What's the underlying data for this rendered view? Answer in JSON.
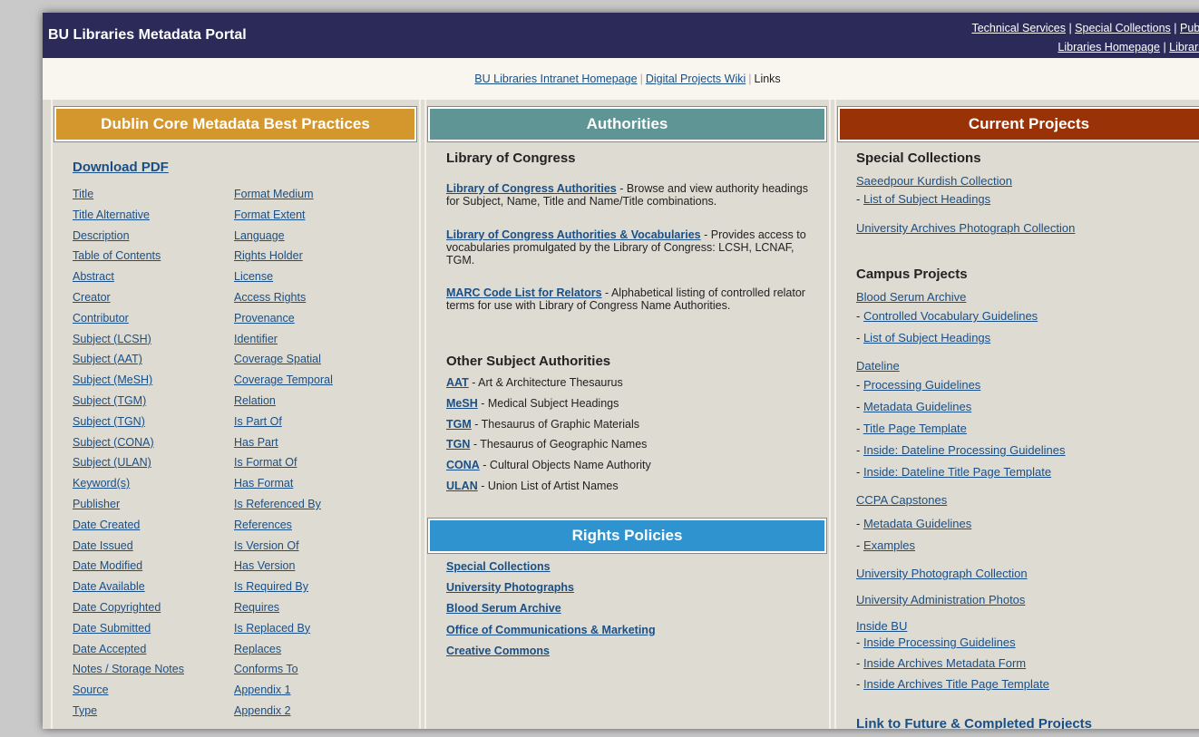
{
  "header": {
    "site_title": "BU Libraries Metadata Portal",
    "top_links_row1": [
      "Technical Services",
      "Special Collections",
      "Public Servi"
    ],
    "top_links_row2": [
      "Libraries Homepage",
      "Libraries Cata"
    ]
  },
  "subnav": {
    "intranet": "BU Libraries Intranet Homepage",
    "wiki": "Digital Projects Wiki",
    "links": "Links",
    "sep": "|"
  },
  "dublin_core": {
    "heading": "Dublin Core Metadata Best Practices",
    "download": "Download PDF",
    "left_fields": [
      "Title",
      "Title Alternative",
      "Description",
      "Table of Contents",
      "Abstract",
      "Creator",
      "Contributor",
      "Subject (LCSH)",
      "Subject (AAT)",
      "Subject (MeSH)",
      "Subject (TGM)",
      "Subject (TGN)",
      "Subject (CONA)",
      "Subject (ULAN)",
      "Keyword(s)",
      "Publisher",
      "Date Created",
      "Date Issued",
      "Date Modified",
      "Date Available",
      "Date Copyrighted",
      "Date Submitted",
      "Date Accepted",
      "Notes / Storage Notes",
      "Source",
      "Type"
    ],
    "right_fields": [
      "Format Medium",
      "Format Extent",
      "Language",
      "Rights Holder",
      "License",
      "Access Rights",
      "Provenance",
      "Identifier",
      "Coverage Spatial",
      "Coverage Temporal",
      "Relation",
      "Is Part Of",
      "Has Part",
      "Is Format Of",
      "Has Format",
      "Is Referenced By",
      "References",
      "Is Version Of",
      "Has Version",
      "Is Required By",
      "Requires",
      "Is Replaced By",
      "Replaces",
      "Conforms To",
      "Appendix 1",
      "Appendix 2"
    ]
  },
  "authorities": {
    "heading": "Authorities",
    "loc_title": "Library of Congress",
    "loc_entries": [
      {
        "link": "Library of Congress Authorities",
        "desc": " - Browse and view authority headings for Subject, Name, Title and Name/Title combinations."
      },
      {
        "link": "Library of Congress Authorities & Vocabularies",
        "desc": " - Provides access to vocabularies promulgated by the Library of Congress: LCSH, LCNAF, TGM."
      },
      {
        "link": "MARC Code List for Relators",
        "desc": " - Alphabetical listing of controlled relator terms for use with Library of Congress Name Authorities."
      }
    ],
    "other_title": "Other Subject Authorities",
    "other": [
      {
        "link": "AAT",
        "desc": " - Art & Architecture Thesaurus"
      },
      {
        "link": "MeSH",
        "desc": " - Medical Subject Headings"
      },
      {
        "link": "TGM",
        "desc": " - Thesaurus of Graphic Materials"
      },
      {
        "link": "TGN",
        "desc": " - Thesaurus of Geographic Names"
      },
      {
        "link": "CONA",
        "desc": " - Cultural Objects Name Authority"
      },
      {
        "link": "ULAN",
        "desc": " - Union List of Artist Names"
      }
    ]
  },
  "rights": {
    "heading": "Rights Policies",
    "items": [
      "Special Collections",
      "University Photographs",
      "Blood Serum Archive",
      "Office of Communications & Marketing",
      "Creative Commons"
    ]
  },
  "projects": {
    "heading": "Current Projects",
    "special_title": "Special Collections",
    "saeedpour": "Saeedpour Kurdish Collection",
    "saeedpour_sub": [
      "List of Subject Headings"
    ],
    "archives_photo": "University Archives Photograph Collection",
    "campus_title": "Campus Projects",
    "blood": "Blood Serum Archive",
    "blood_sub": [
      "Controlled Vocabulary Guidelines",
      "List of Subject Headings"
    ],
    "dateline": "Dateline",
    "dateline_sub": [
      "Processing Guidelines",
      "Metadata Guidelines",
      "Title Page Template",
      "Inside: Dateline Processing Guidelines",
      "Inside: Dateline Title Page Template"
    ],
    "ccpa": "CCPA Capstones",
    "ccpa_sub": [
      "Metadata Guidelines",
      "Examples"
    ],
    "univ_photo": "University Photograph Collection",
    "univ_admin": "University Administration Photos",
    "inside_bu": "Inside BU",
    "inside_sub": [
      "Inside Processing Guidelines",
      "Inside Archives Metadata Form",
      "Inside Archives Title Page Template"
    ],
    "future": "Link to Future & Completed Projects",
    "dash": "- "
  }
}
